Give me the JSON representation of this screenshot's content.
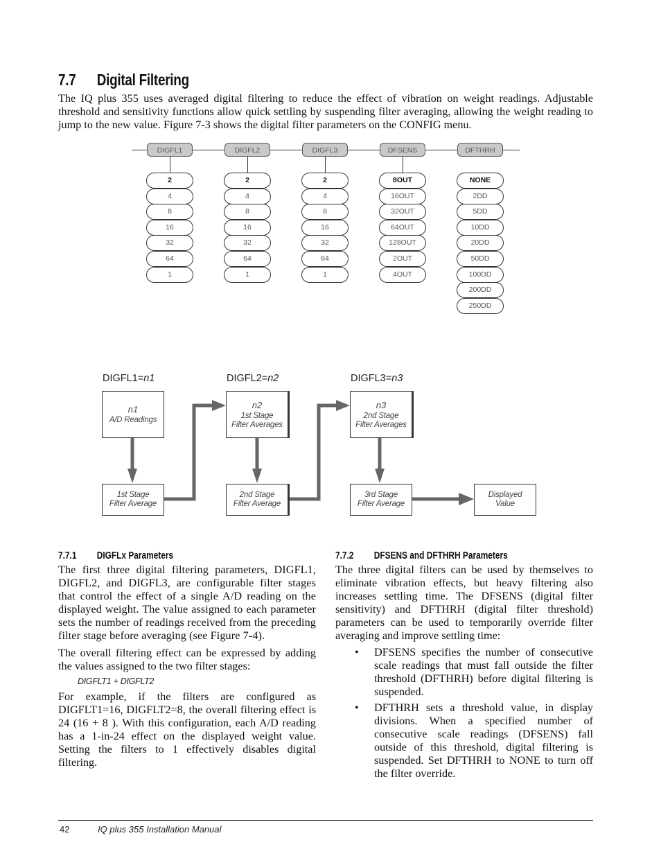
{
  "section": {
    "number": "7.7",
    "title": "Digital Filtering",
    "intro": "The IQ plus 355 uses averaged digital filtering to reduce the effect of vibration on weight readings. Adjustable threshold and sensitivity functions allow quick settling by suspending filter averaging, allowing the weight reading to jump to the new value. Figure 7-3 shows the digital filter parameters on the CONFIG menu."
  },
  "menu_diagram": {
    "parameters": [
      {
        "name": "DIGFL1",
        "options": [
          "2",
          "4",
          "8",
          "16",
          "32",
          "64",
          "1"
        ],
        "default": "2",
        "connected": true
      },
      {
        "name": "DIGFL2",
        "options": [
          "2",
          "4",
          "8",
          "16",
          "32",
          "64",
          "1"
        ],
        "default": "2",
        "connected": true
      },
      {
        "name": "DIGFL3",
        "options": [
          "2",
          "4",
          "8",
          "16",
          "32",
          "64",
          "1"
        ],
        "default": "2",
        "connected": true
      },
      {
        "name": "DFSENS",
        "options": [
          "8OUT",
          "16OUT",
          "32OUT",
          "64OUT",
          "128OUT",
          "2OUT",
          "4OUT"
        ],
        "default": "8OUT",
        "connected": true
      },
      {
        "name": "DFTHRH",
        "options": [
          "NONE",
          "2DD",
          "5DD",
          "10DD",
          "20DD",
          "50DD",
          "100DD",
          "200DD",
          "250DD"
        ],
        "default": "NONE",
        "connected": false
      }
    ]
  },
  "flow_diagram": {
    "labels": [
      {
        "prefix": "DIGFL1=",
        "var": "n1"
      },
      {
        "prefix": "DIGFL2=",
        "var": "n2"
      },
      {
        "prefix": "DIGFL3=",
        "var": "n3"
      }
    ],
    "top_boxes": [
      {
        "var": "n1",
        "lines": [
          "A/D Readings"
        ]
      },
      {
        "var": "n2",
        "lines": [
          "1st Stage",
          "Filter Averages"
        ]
      },
      {
        "var": "n3",
        "lines": [
          "2nd Stage",
          "Filter Averages"
        ]
      }
    ],
    "bottom_boxes": [
      {
        "lines": [
          "1st Stage",
          "Filter Average"
        ]
      },
      {
        "lines": [
          "2nd Stage",
          "Filter Average"
        ]
      },
      {
        "lines": [
          "3rd Stage",
          "Filter Average"
        ]
      },
      {
        "lines": [
          "Displayed",
          "Value"
        ]
      }
    ],
    "line_color": "#666666"
  },
  "sub1": {
    "number": "7.7.1",
    "title": "DIGFLx Parameters",
    "p1": "The first three digital filtering parameters, DIGFL1, DIGFL2, and DIGFL3, are configurable filter stages that control the effect of a single A/D reading on the displayed weight. The value assigned to each parameter sets the number of readings received from the preceding filter stage before averaging (see Figure 7-4).",
    "p2": "The overall filtering effect can be expressed by adding the values assigned to the two filter stages:",
    "formula": "DIGFLT1 + DIGFLT2",
    "p3": "For example, if the filters are configured as DIGFLT1=16, DIGFLT2=8,  the overall filtering effect is 24 (16 + 8 ). With this configuration, each  A/D reading has a 1-in-24 effect on the displayed weight value. Setting the filters to 1 effectively disables digital filtering."
  },
  "sub2": {
    "number": "7.7.2",
    "title": "DFSENS and DFTHRH Parameters",
    "p1": "The three digital filters can be used by themselves to eliminate vibration effects, but heavy filtering also increases settling time. The DFSENS (digital filter sensitivity) and DFTHRH (digital filter threshold) parameters can be used to temporarily override filter averaging and improve settling time:",
    "bullets": [
      "DFSENS specifies the number of consecutive scale readings that must fall outside the filter threshold (DFTHRH) before digital filtering is suspended.",
      "DFTHRH sets a threshold value, in display divisions. When a specified number of consecutive scale readings (DFSENS) fall outside of this threshold, digital filtering is suspended. Set DFTHRH to NONE to turn off the filter override."
    ],
    "bullet_char": "•"
  },
  "footer": {
    "page_number": "42",
    "manual_title": "IQ plus 355 Installation Manual"
  }
}
